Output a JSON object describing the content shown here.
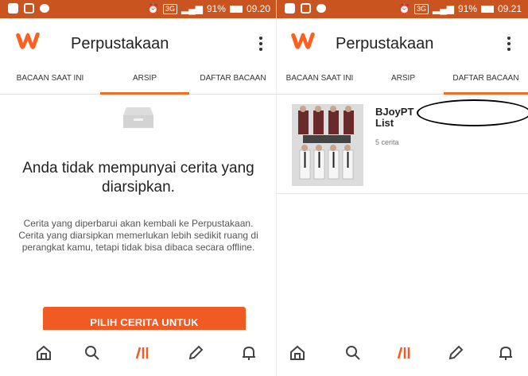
{
  "colors": {
    "accent": "#f15a22",
    "status_bar": "#c9541f",
    "brand_logo": "#ff5f1f",
    "tab_indicator": "#f26f21"
  },
  "left": {
    "status": {
      "signal_badge": "3G",
      "battery": "91%",
      "time": "09.20"
    },
    "app_title": "Perpustakaan",
    "tabs": [
      {
        "label": "BACAAN SAAT INI",
        "active": false
      },
      {
        "label": "ARSIP",
        "active": true
      },
      {
        "label": "DAFTAR BACAAN",
        "active": false
      }
    ],
    "empty_state": {
      "icon": "archive-box-icon",
      "title": "Anda tidak mempunyai cerita yang diarsipkan.",
      "description": "Cerita yang diperbarui akan kembali ke Perpustakaan. Cerita yang diarsipkan memerlukan lebih sedikit ruang di perangkat kamu, tetapi tidak bisa dibaca secara offline.",
      "button": "PILIH CERITA UNTUK"
    }
  },
  "right": {
    "status": {
      "signal_badge": "3G",
      "battery": "91%",
      "time": "09.21"
    },
    "app_title": "Perpustakaan",
    "tabs": [
      {
        "label": "BACAAN SAAT INI",
        "active": false
      },
      {
        "label": "ARSIP",
        "active": false
      },
      {
        "label": "DAFTAR BACAAN",
        "active": true
      }
    ],
    "reading_list": [
      {
        "name": "BJoyPT List",
        "count": "5 cerita"
      }
    ]
  },
  "bottom_nav": [
    {
      "icon": "home-icon"
    },
    {
      "icon": "search-icon"
    },
    {
      "icon": "library-icon",
      "active": true
    },
    {
      "icon": "pencil-icon"
    },
    {
      "icon": "bell-icon"
    }
  ]
}
